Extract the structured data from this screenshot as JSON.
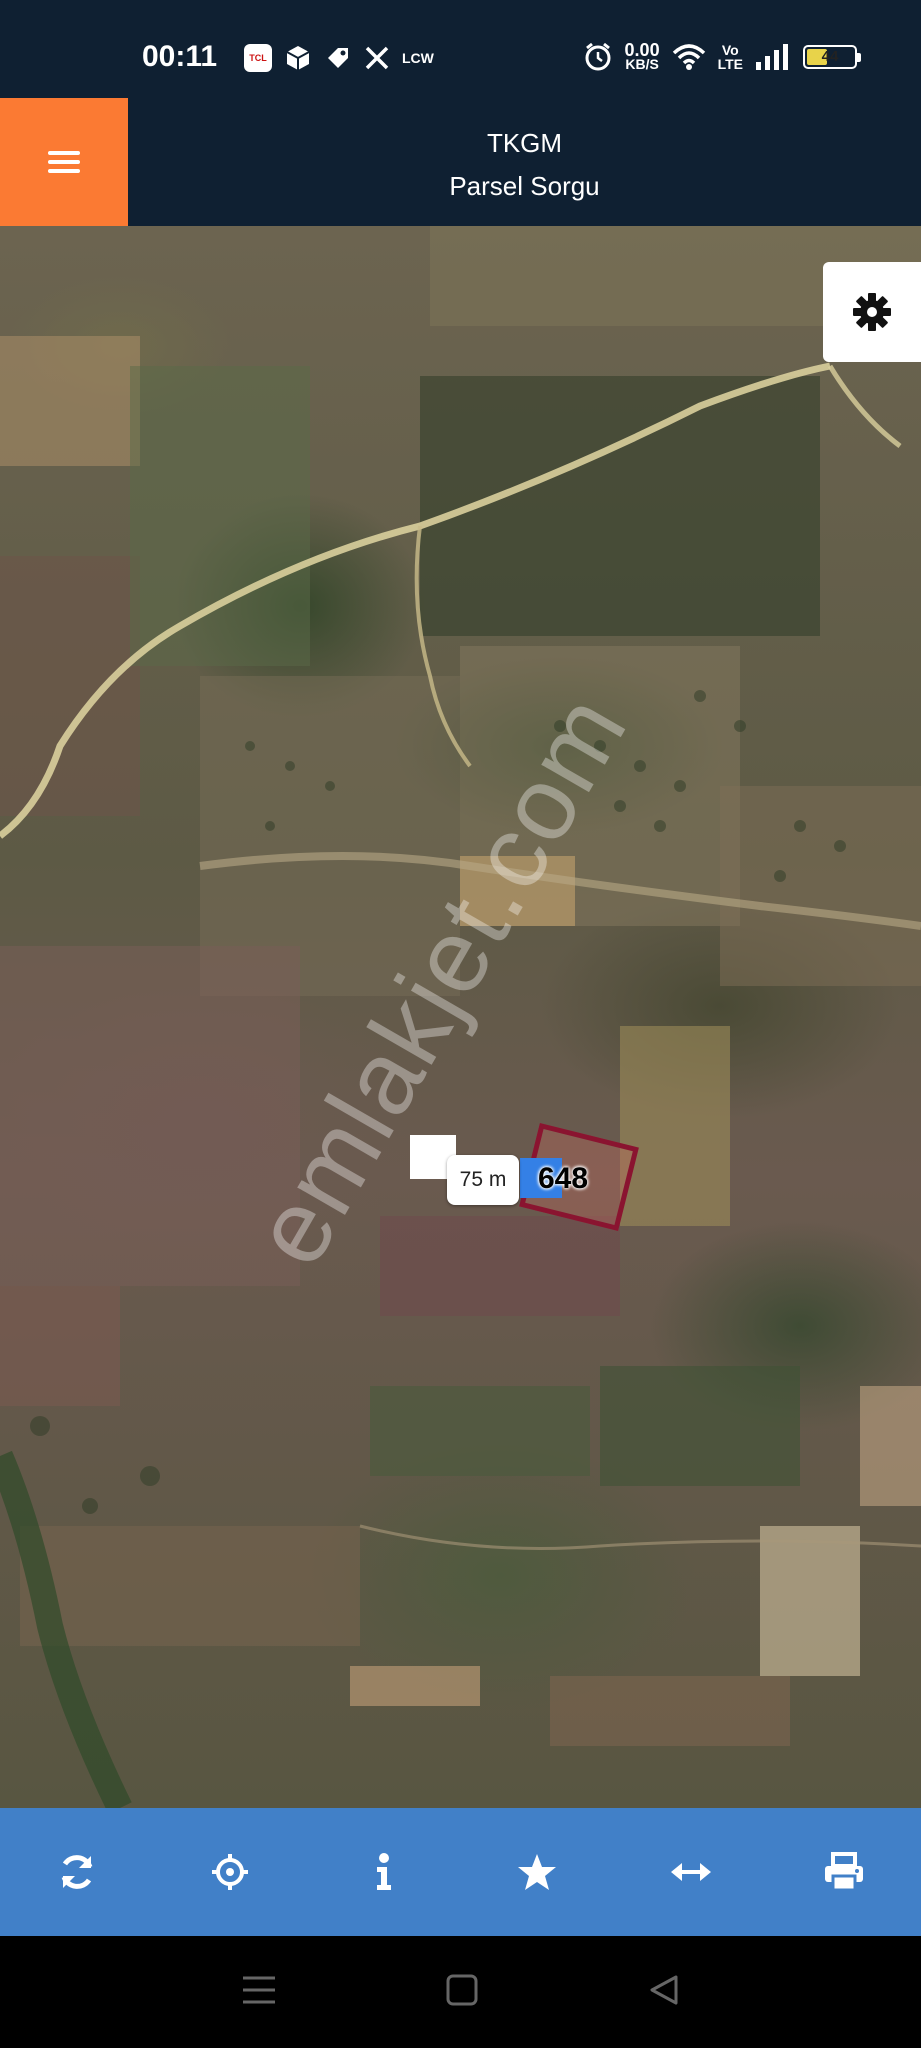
{
  "status_bar": {
    "time": "00:11",
    "notification_icons": [
      "tcl-icon",
      "package-icon",
      "tag-icon",
      "x-icon",
      "lcw-icon"
    ],
    "tcl_label": "TCL",
    "lcw_label": "LCW",
    "net_speed_value": "0.00",
    "net_speed_unit": "KB/S",
    "volte_top": "Vo",
    "volte_bottom": "LTE",
    "battery_level": "44",
    "battery_color": "#e8d34a"
  },
  "header": {
    "title": "TKGM",
    "subtitle": "Parsel Sorgu",
    "menu_color": "#fb7a33",
    "background": "#0f2032"
  },
  "map": {
    "parcel_number": "648",
    "scale_label": "75 m",
    "watermark": "emlakjet.com",
    "parcel_border_color": "#8a1430",
    "label_color": "#3480e6"
  },
  "toolbar": {
    "background": "#4180c8",
    "buttons": [
      "refresh-icon",
      "locate-icon",
      "info-icon",
      "star-icon",
      "measure-icon",
      "print-icon"
    ]
  },
  "navigation": {
    "buttons": [
      "menu-icon",
      "home-icon",
      "back-icon"
    ]
  }
}
